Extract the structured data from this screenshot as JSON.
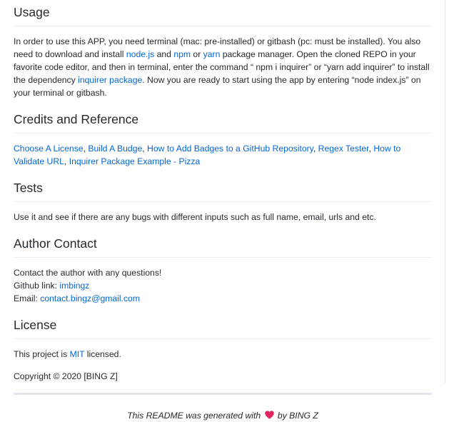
{
  "usage": {
    "heading": "Usage",
    "t1": "In order to use this APP, you need terminal (mac: pre-installed) or gitbash (pc: must be installed). You also need to download and install ",
    "link_node": "node.js",
    "t2": " and ",
    "link_npm": "npm",
    "t3": " or ",
    "link_yarn": "yarn",
    "t4": " package manager. Open the cloned REPO in your favorite code editor, and then in terminal, enter the command “ npm i inquirer” or “yarn add inquirer” to install the dependency ",
    "link_inquirer": "inquirer package",
    "t5": ". Now you are ready to start using the app by entering “node index.js” on your terminal or gitbash."
  },
  "credits": {
    "heading": "Credits and Reference",
    "links": [
      "Choose A License",
      "Build A Budge",
      "How to Add Badges to a GitHub Repository",
      "Regex Tester",
      "How to Validate URL",
      "Inquirer Package Example - Pizza"
    ],
    "sep": ", "
  },
  "tests": {
    "heading": "Tests",
    "text": "Use it and see if there are any bugs with different inputs such as full name, email, urls and etc."
  },
  "author": {
    "heading": "Author Contact",
    "line1": "Contact the author with any questions!",
    "github_label": "Github link: ",
    "github_link": "imbingz",
    "email_label": "Email: ",
    "email_link": "contact.bingz@gmail.com"
  },
  "license": {
    "heading": "License",
    "t1": "This project is ",
    "link": "MIT",
    "t2": " licensed.",
    "copyright": "Copyright © 2020 [BING Z]"
  },
  "footer": {
    "before": "This README was generated with ",
    "after": " by BING Z",
    "heart_color": "#e0245e"
  },
  "colors": {
    "link": "#0366d6",
    "text": "#24292e",
    "rule": "#eaecef"
  }
}
